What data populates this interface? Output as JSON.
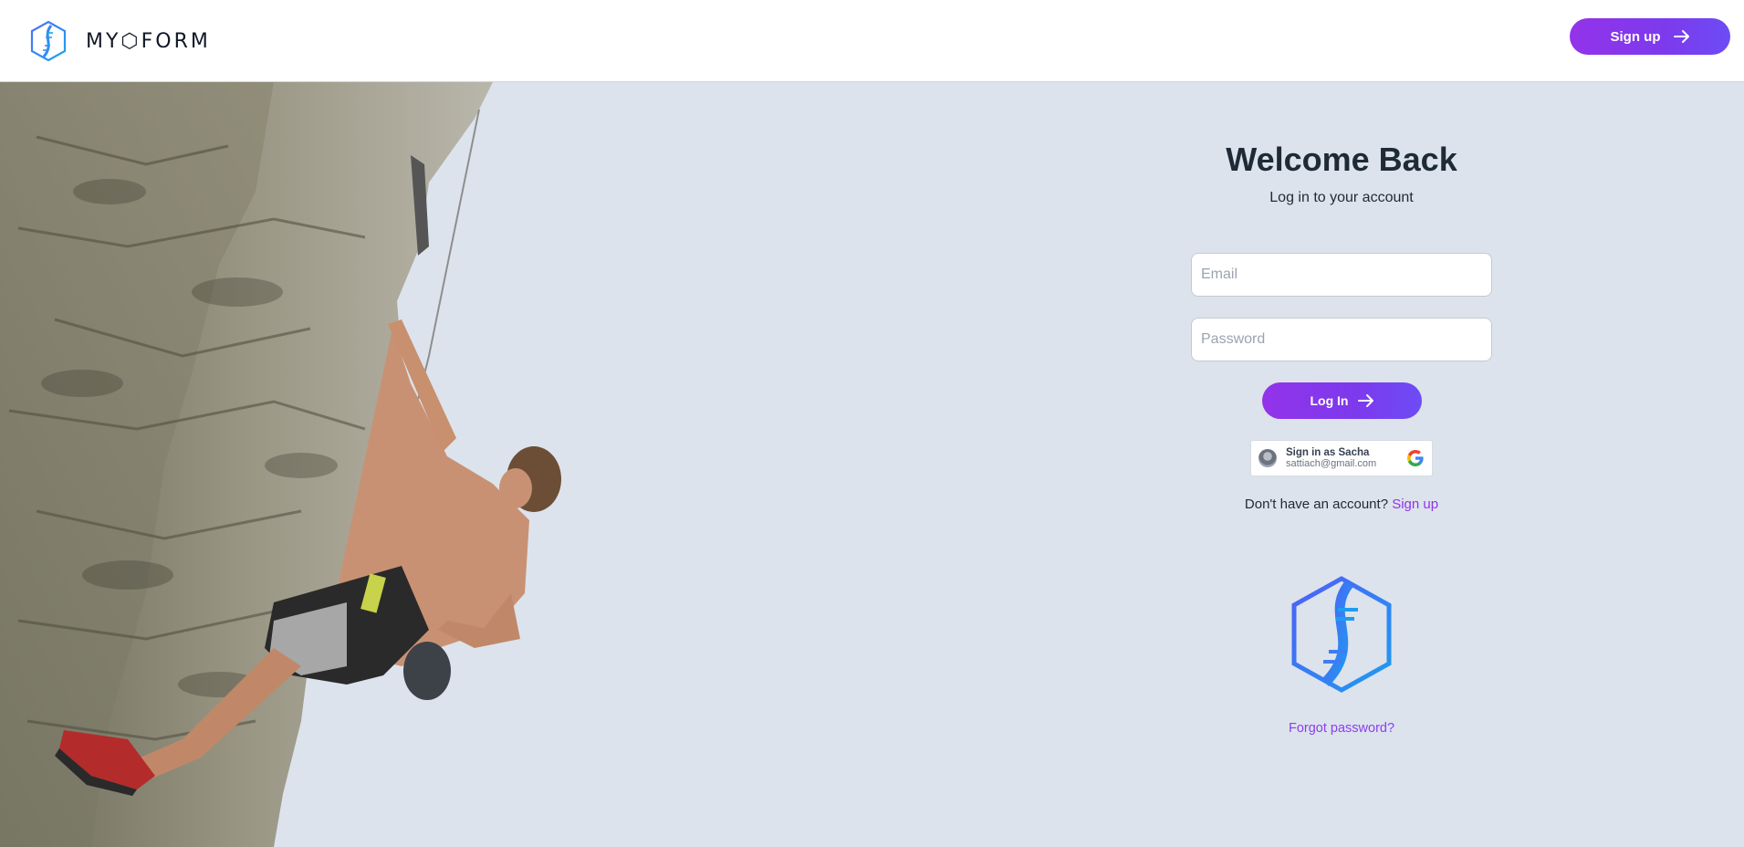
{
  "header": {
    "brand_name": "MY⬡FORM",
    "signup_label": "Sign up"
  },
  "login": {
    "title": "Welcome Back",
    "subtitle": "Log in to your account",
    "email_placeholder": "Email",
    "password_placeholder": "Password",
    "login_label": "Log In",
    "google": {
      "name_line": "Sign in as Sacha",
      "email_line": "sattiach@gmail.com"
    },
    "no_account_text": "Don't have an account?",
    "signup_link": "Sign up",
    "forgot_password": "Forgot password?"
  },
  "icons": {
    "brand": "dna-hexagon-icon",
    "arrow": "arrow-right-icon",
    "google": "google-g-icon"
  },
  "colors": {
    "accent": "#9333ea",
    "accent_end": "#6d4cf5",
    "background": "#dce3ec",
    "logo_blue": "#2f7cf6"
  }
}
